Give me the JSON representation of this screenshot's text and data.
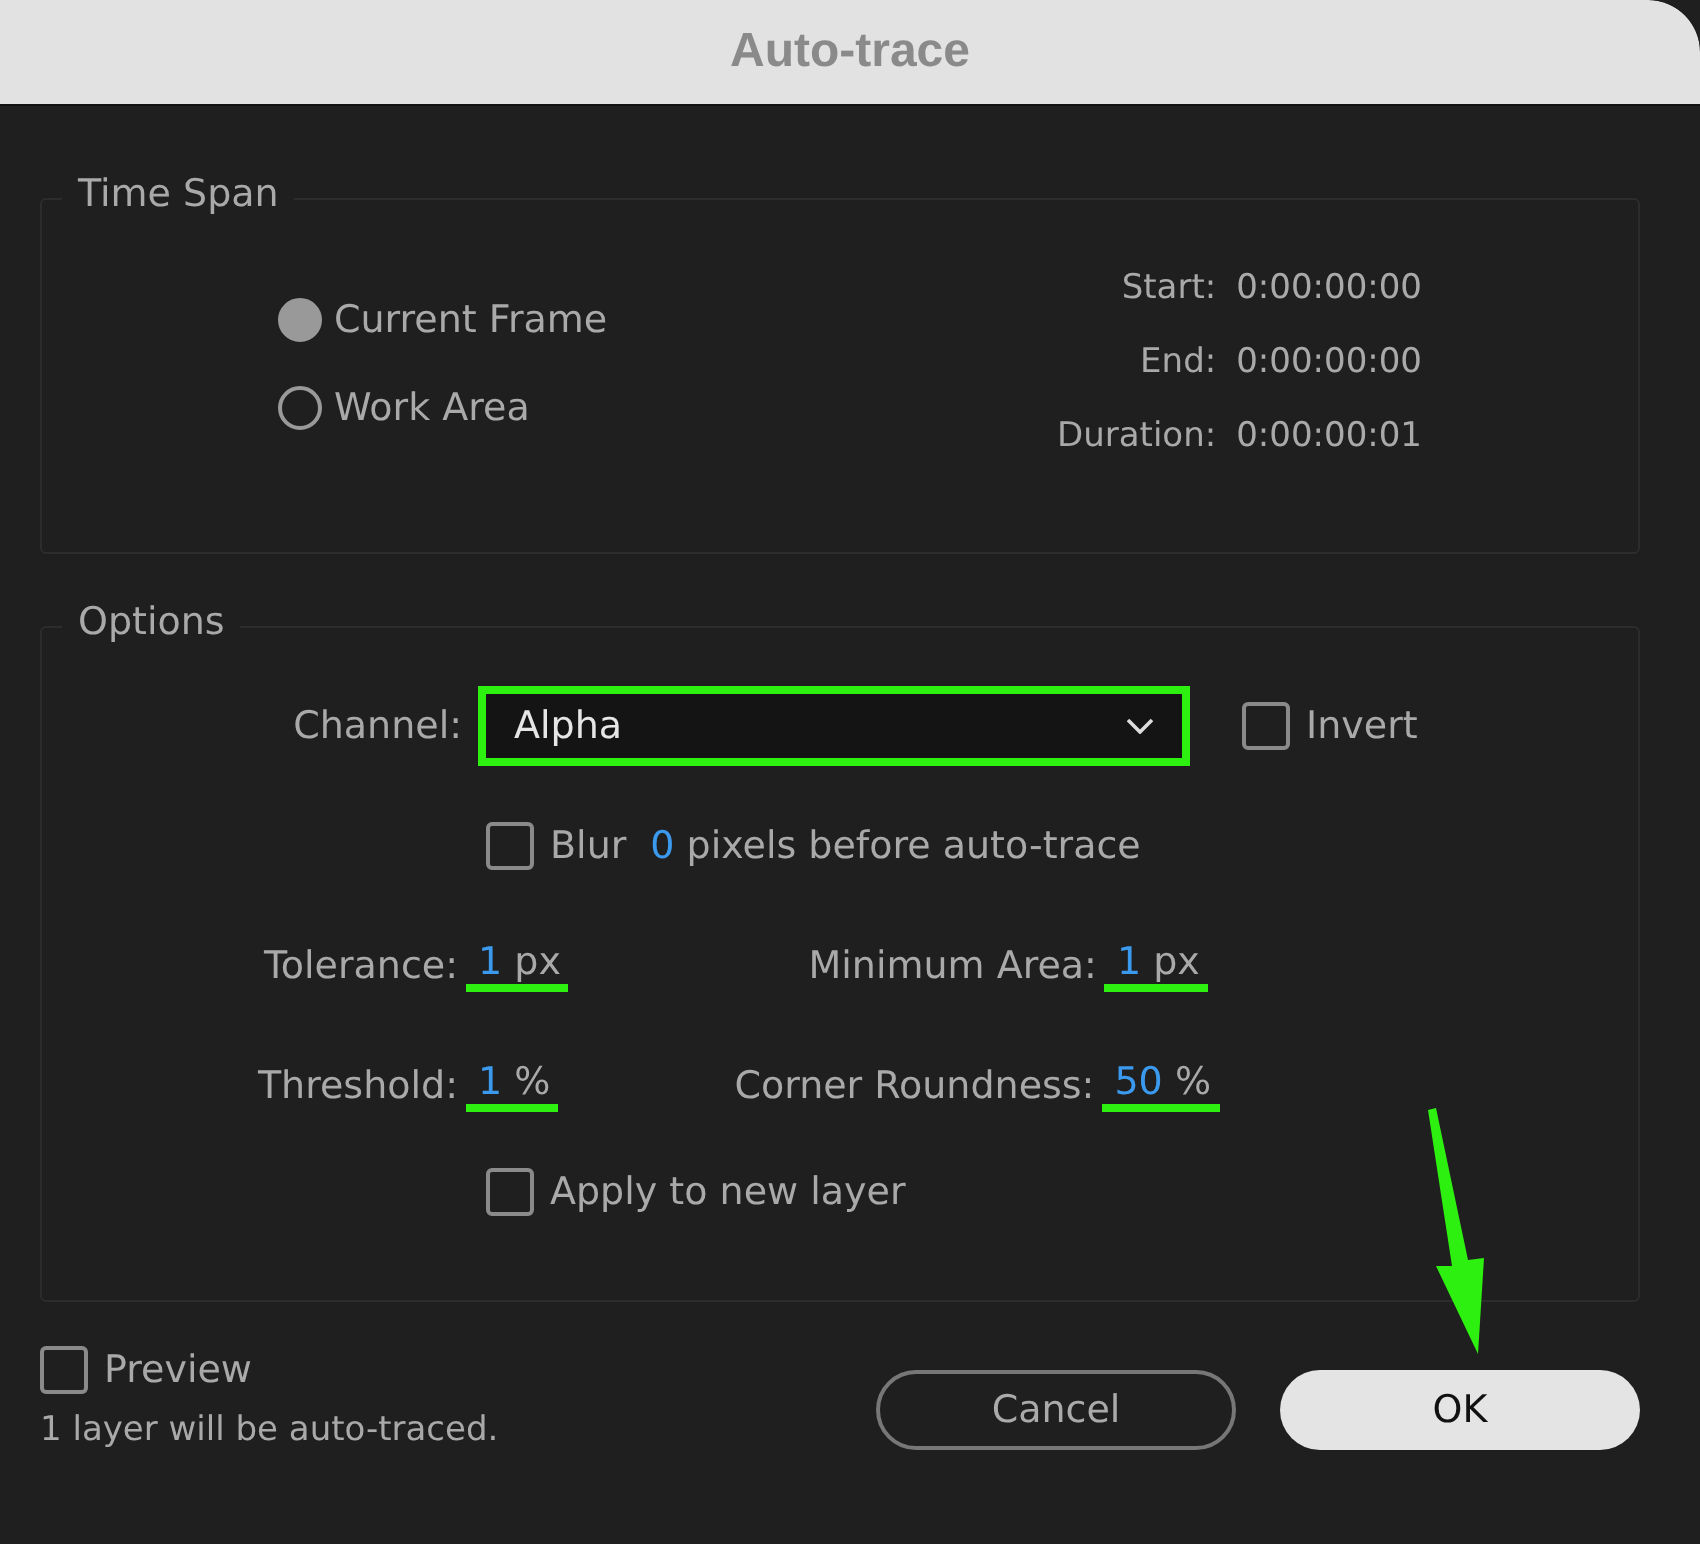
{
  "window": {
    "title": "Auto-trace"
  },
  "time_span": {
    "legend": "Time Span",
    "options": [
      {
        "label": "Current Frame",
        "selected": true
      },
      {
        "label": "Work Area",
        "selected": false
      }
    ],
    "fields": [
      {
        "label": "Start:",
        "value": "0:00:00:00"
      },
      {
        "label": "End:",
        "value": "0:00:00:00"
      },
      {
        "label": "Duration:",
        "value": "0:00:00:01"
      }
    ]
  },
  "options": {
    "legend": "Options",
    "channel": {
      "label": "Channel:",
      "value": "Alpha",
      "highlighted": true
    },
    "invert": {
      "label": "Invert",
      "checked": false
    },
    "blur": {
      "label": "Blur",
      "checked": false,
      "value": "0",
      "suffix": "pixels before auto-trace"
    },
    "params": [
      {
        "label": "Tolerance:",
        "value": "1",
        "unit": "px",
        "highlighted": true
      },
      {
        "label": "Minimum Area:",
        "value": "1",
        "unit": "px",
        "highlighted": true
      },
      {
        "label": "Threshold:",
        "value": "1",
        "unit": "%",
        "highlighted": true
      },
      {
        "label": "Corner Roundness:",
        "value": "50",
        "unit": "%",
        "highlighted": true
      }
    ],
    "apply_new_layer": {
      "label": "Apply to new layer",
      "checked": false
    }
  },
  "preview": {
    "label": "Preview",
    "checked": false
  },
  "status": "1 layer will be auto-traced.",
  "buttons": [
    {
      "label": "Cancel",
      "kind": "secondary"
    },
    {
      "label": "OK",
      "kind": "primary",
      "highlighted": true
    }
  ]
}
